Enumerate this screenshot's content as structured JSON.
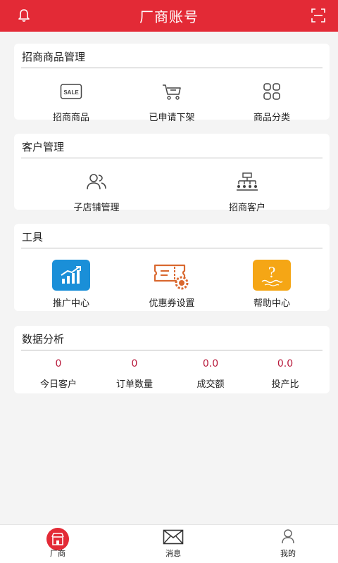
{
  "header": {
    "title": "厂商账号",
    "left_icon": "bell-icon",
    "right_icon": "scan-icon"
  },
  "cards": {
    "merchant_goods": {
      "title": "招商商品管理",
      "items": [
        {
          "label": "招商商品",
          "icon": "sale-tag-icon"
        },
        {
          "label": "已申请下架",
          "icon": "cart-remove-icon"
        },
        {
          "label": "商品分类",
          "icon": "grid-icon"
        }
      ]
    },
    "customer": {
      "title": "客户管理",
      "items": [
        {
          "label": "子店铺管理",
          "icon": "users-icon"
        },
        {
          "label": "招商客户",
          "icon": "org-chart-icon"
        }
      ]
    },
    "tools": {
      "title": "工具",
      "items": [
        {
          "label": "推广中心",
          "icon": "bar-chart-icon",
          "color": "#1a8fd8"
        },
        {
          "label": "优惠券设置",
          "icon": "coupon-gear-icon",
          "color": "#d9682f"
        },
        {
          "label": "帮助中心",
          "icon": "help-icon",
          "color": "#f5a615"
        }
      ]
    },
    "analytics": {
      "title": "数据分析",
      "stats": [
        {
          "value": "0",
          "label": "今日客户"
        },
        {
          "value": "0",
          "label": "订单数量"
        },
        {
          "value": "0.0",
          "label": "成交额"
        },
        {
          "value": "0.0",
          "label": "投产比"
        }
      ]
    }
  },
  "tabbar": {
    "tabs": [
      {
        "label": "厂商",
        "icon": "store-icon",
        "active": true
      },
      {
        "label": "消息",
        "icon": "mail-icon"
      },
      {
        "label": "我的",
        "icon": "user-icon"
      }
    ]
  },
  "colors": {
    "primary": "#e32a36",
    "stat_value": "#b8183a"
  }
}
